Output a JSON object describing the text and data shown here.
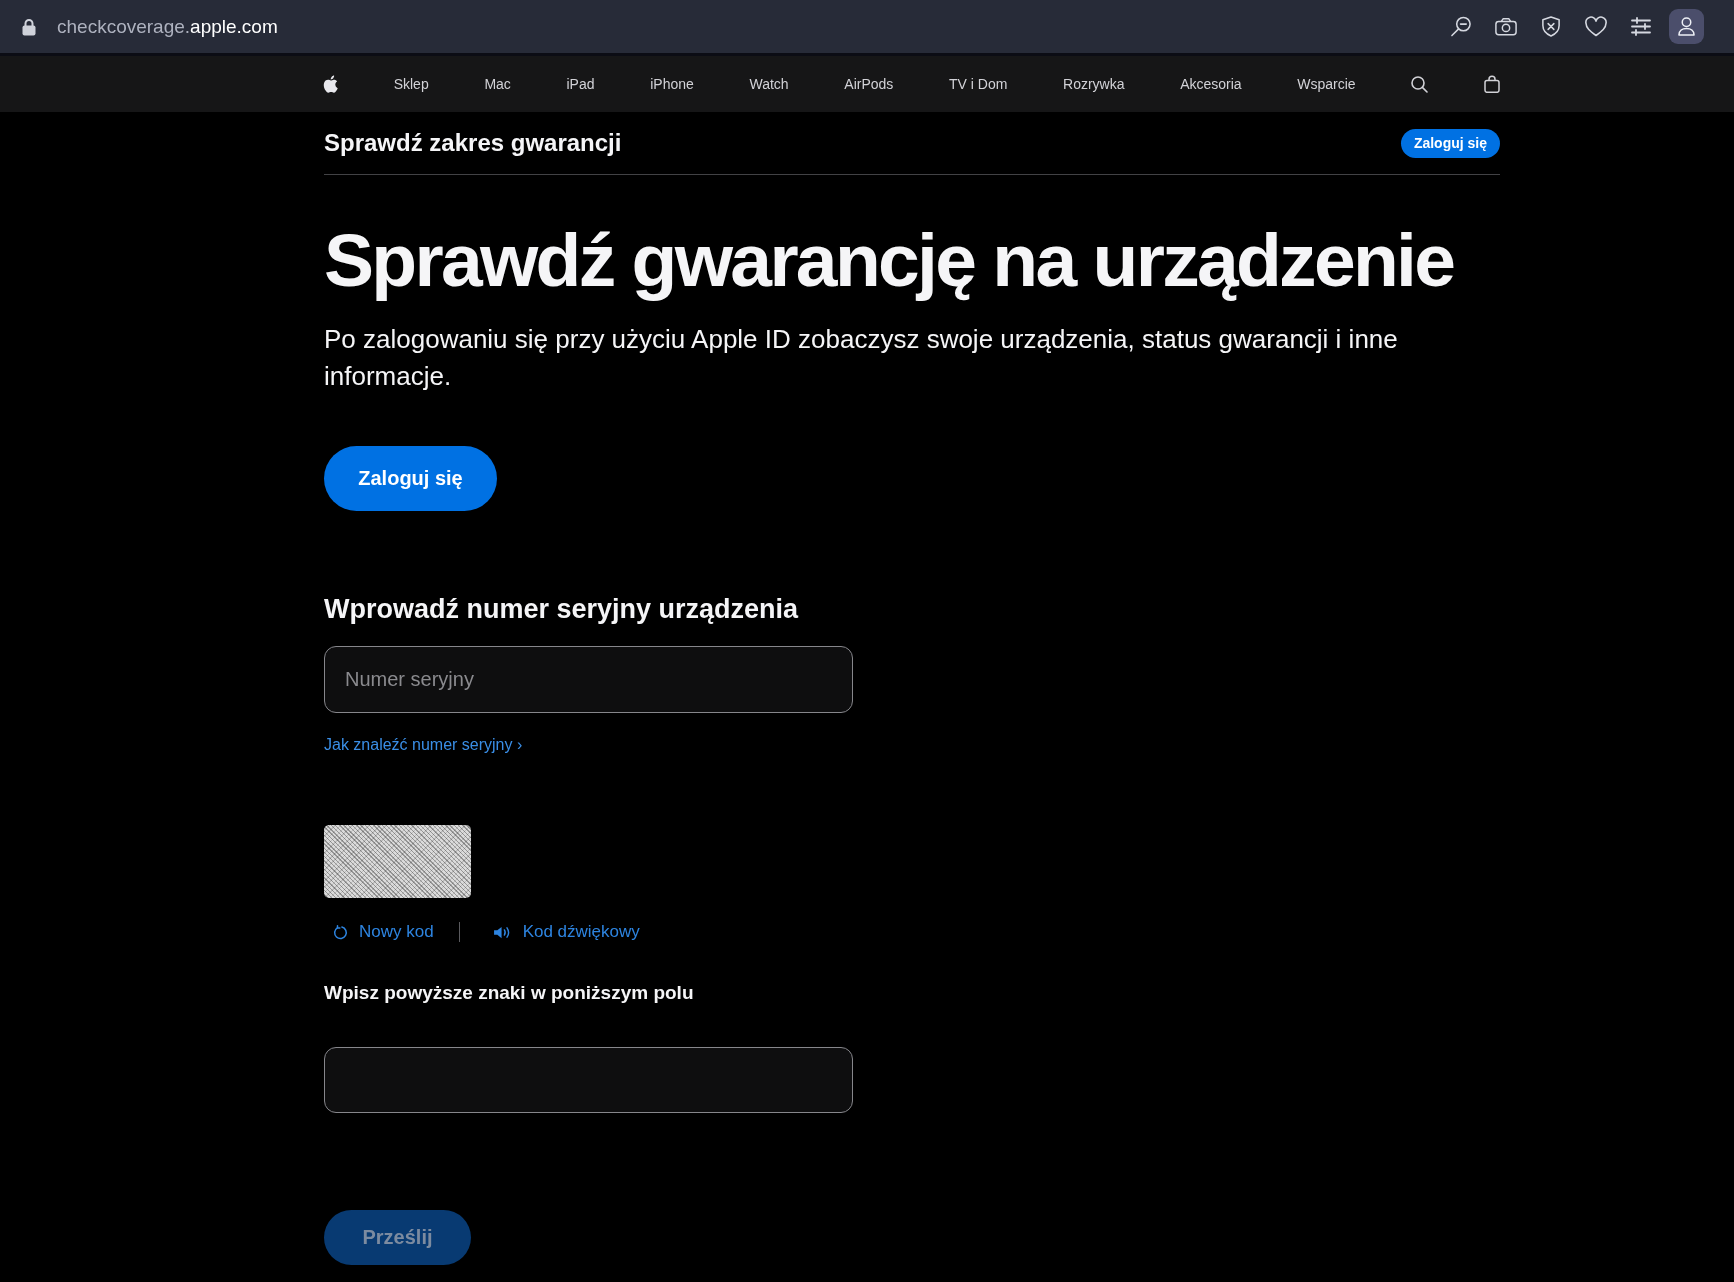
{
  "browser": {
    "address": {
      "subdomain": "checkcoverage.",
      "domain": "apple.com"
    }
  },
  "nav": {
    "items": [
      "Sklep",
      "Mac",
      "iPad",
      "iPhone",
      "Watch",
      "AirPods",
      "TV i Dom",
      "Rozrywka",
      "Akcesoria",
      "Wsparcie"
    ]
  },
  "subnav": {
    "title": "Sprawdź zakres gwarancji",
    "sign_in_button": "Zaloguj się"
  },
  "hero": {
    "title": "Sprawdź gwarancję na urządzenie",
    "subtitle": "Po zalogowaniu się przy użyciu Apple ID zobaczysz swoje urządzenia, status gwarancji i inne informacje.",
    "sign_in_button": "Zaloguj się"
  },
  "serial_number": {
    "heading": "Wprowadź numer seryjny urządzenia",
    "field": {
      "placeholder": "Numer seryjny"
    },
    "help_link": "Jak znaleźć numer seryjny ›"
  },
  "captcha": {
    "actions": [
      {
        "kind": "refresh",
        "label": "Nowy kod"
      },
      {
        "kind": "audio",
        "label": "Kod dźwiękowy"
      }
    ],
    "prompt": "Wpisz powyższe znaki w poniższym polu"
  },
  "submit_button": {
    "label": "Prześlij",
    "disabled": true
  }
}
